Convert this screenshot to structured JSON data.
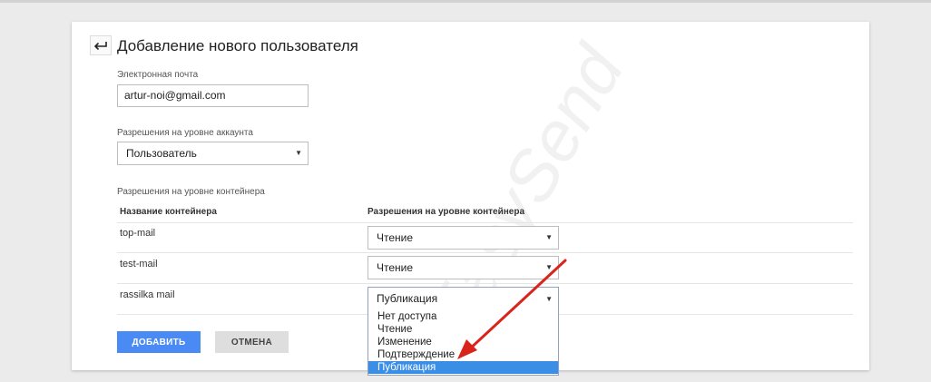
{
  "watermark": "EasySend",
  "page": {
    "title": "Добавление нового пользователя"
  },
  "email": {
    "label": "Электронная почта",
    "value": "artur-noi@gmail.com"
  },
  "account": {
    "label": "Разрешения на уровне аккаунта",
    "value": "Пользователь"
  },
  "containers": {
    "label": "Разрешения на уровне контейнера",
    "col_name": "Название контейнера",
    "col_perm": "Разрешения на уровне контейнера",
    "rows": [
      {
        "name": "top-mail",
        "perm": "Чтение"
      },
      {
        "name": "test-mail",
        "perm": "Чтение"
      },
      {
        "name": "rassilka mail",
        "perm": "Публикация"
      }
    ]
  },
  "dropdown": {
    "options": [
      "Нет доступа",
      "Чтение",
      "Изменение",
      "Подтверждение",
      "Публикация"
    ],
    "selected": "Публикация"
  },
  "buttons": {
    "add": "ДОБАВИТЬ",
    "cancel": "ОТМЕНА"
  },
  "colors": {
    "accent": "#4a8af4",
    "highlight": "#3b8ee6",
    "arrow": "#d9241b"
  },
  "icons": {
    "back": "back-arrow-icon",
    "dropdown": "triangle-down-icon"
  }
}
